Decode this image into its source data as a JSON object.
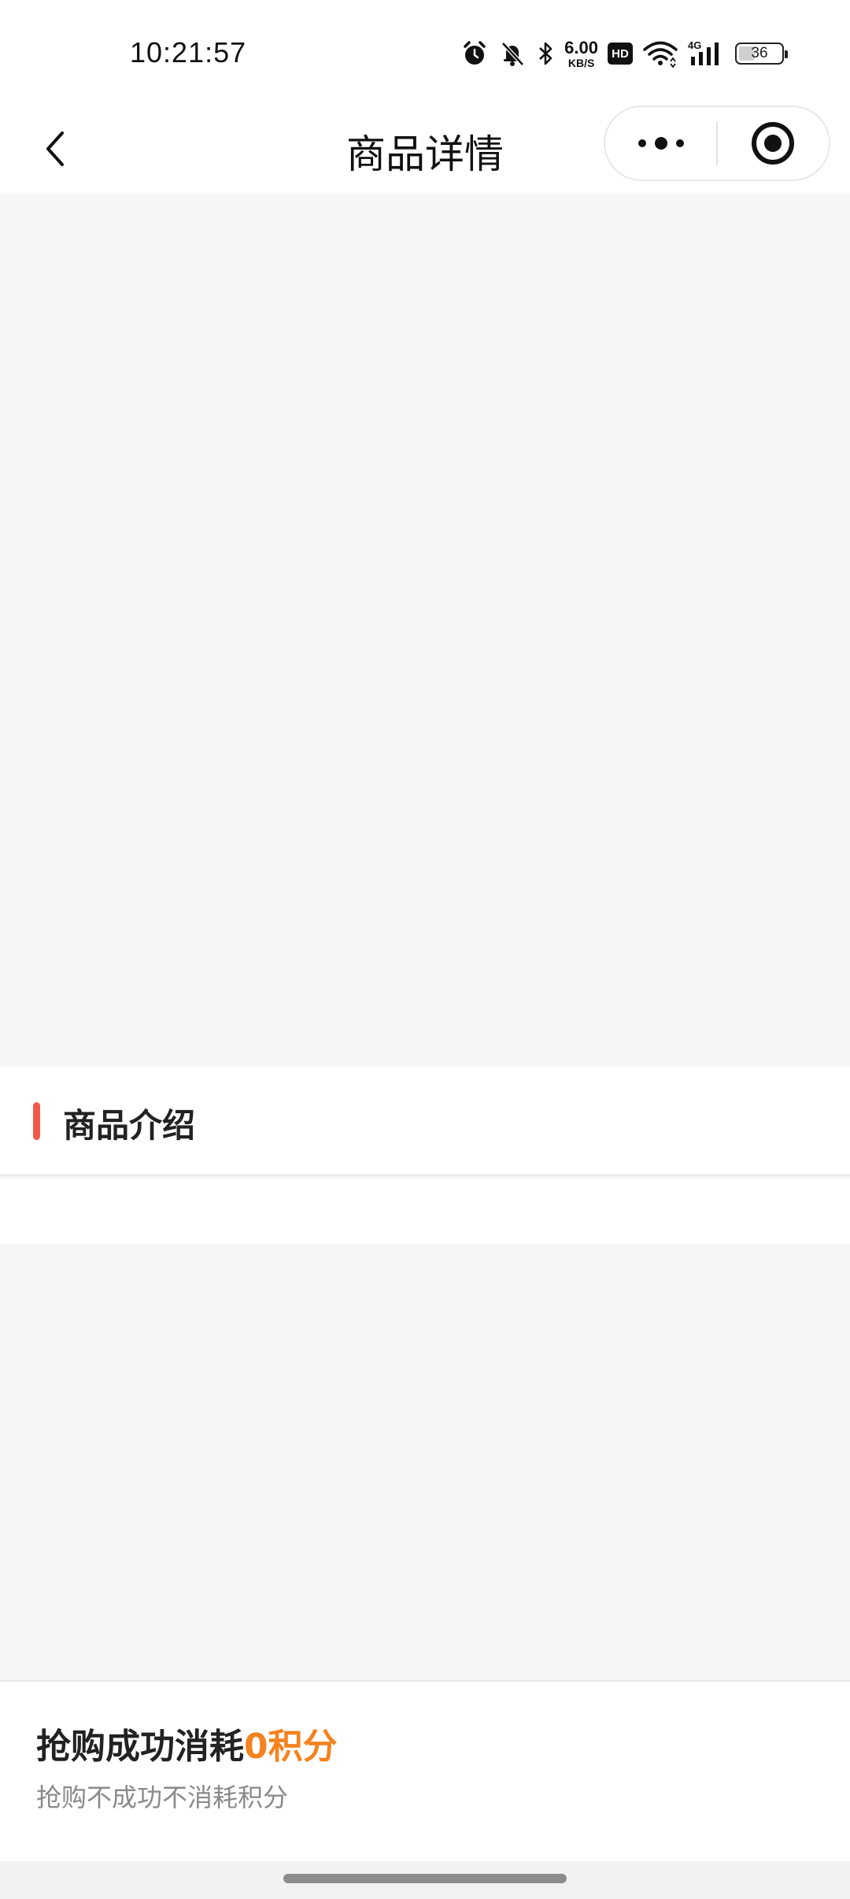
{
  "status_bar": {
    "time": "10:21:57",
    "network_speed_value": "6.00",
    "network_speed_unit": "KB/S",
    "hd_label": "HD",
    "network_type": "4G",
    "battery_level": "36",
    "icons": [
      "alarm-icon",
      "mute-bell-icon",
      "bluetooth-icon",
      "hd-icon",
      "wifi-icon",
      "signal-icon",
      "battery-icon"
    ]
  },
  "nav": {
    "title": "商品详情",
    "back_icon": "chevron-left-icon",
    "more_icon": "more-dots-icon",
    "close_icon": "target-circle-icon"
  },
  "section": {
    "title": "商品介绍",
    "accent_color": "#f0594a"
  },
  "bottom": {
    "cost_prefix": "抢购成功消耗",
    "cost_value": "0积分",
    "cost_color": "#f4821f",
    "note": "抢购不成功不消耗积分"
  }
}
